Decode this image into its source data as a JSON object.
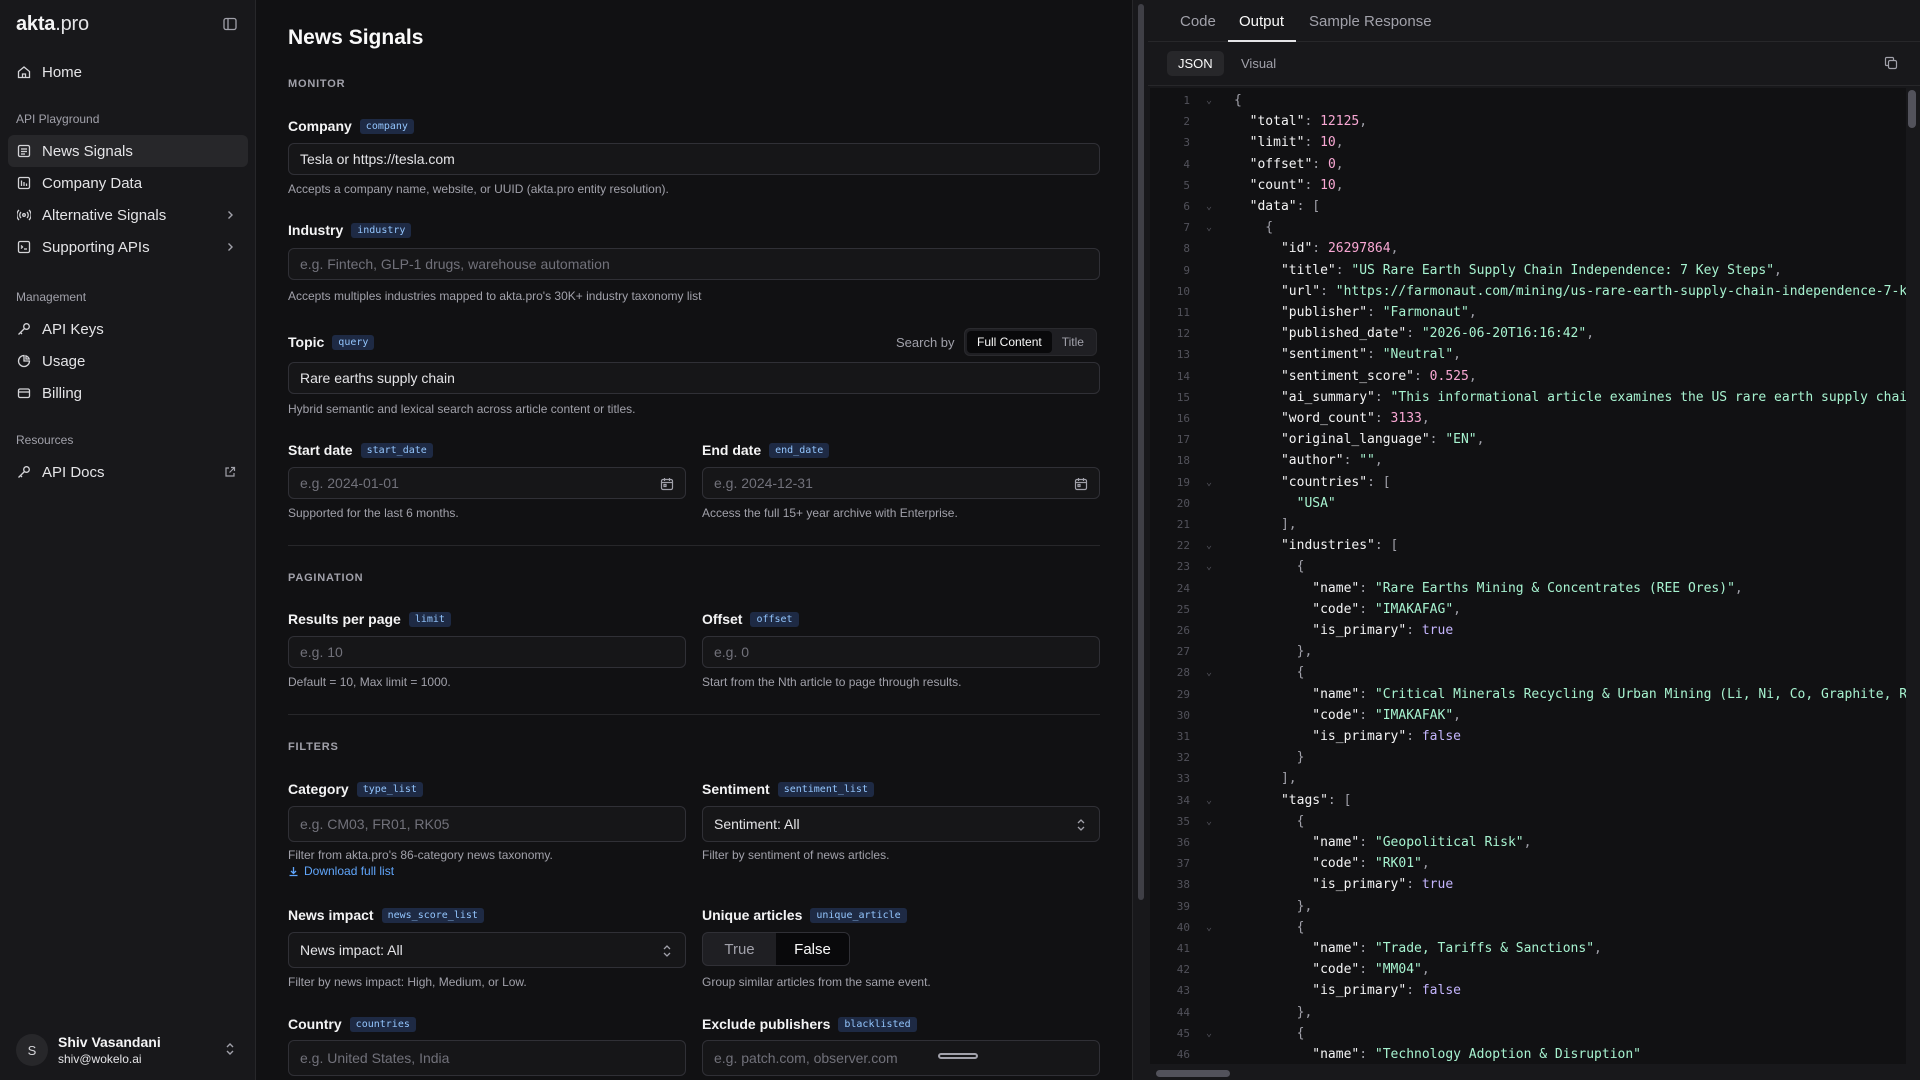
{
  "sidebar": {
    "brand_main": "akta",
    "brand_suffix": ".pro",
    "home": "Home",
    "section_playground": "API Playground",
    "news_signals": "News Signals",
    "company_data": "Company Data",
    "alternative_signals": "Alternative Signals",
    "supporting_apis": "Supporting APIs",
    "section_management": "Management",
    "api_keys": "API Keys",
    "usage": "Usage",
    "billing": "Billing",
    "section_resources": "Resources",
    "api_docs": "API Docs",
    "user_initial": "S",
    "user_name": "Shiv Vasandani",
    "user_email": "shiv@wokelo.ai"
  },
  "form": {
    "title": "News Signals",
    "monitor_label": "MONITOR",
    "company_label": "Company",
    "company_tag": "company",
    "company_value": "Tesla or https://tesla.com",
    "company_help": "Accepts a company name, website, or UUID (akta.pro entity resolution).",
    "industry_label": "Industry",
    "industry_tag": "industry",
    "industry_placeholder": "e.g. Fintech, GLP-1 drugs, warehouse automation",
    "industry_help": "Accepts multiples industries mapped to akta.pro's 30K+ industry taxonomy list",
    "topic_label": "Topic",
    "topic_tag": "query",
    "search_by": "Search by",
    "full_content": "Full Content",
    "title_opt": "Title",
    "topic_value": "Rare earths supply chain",
    "topic_help": "Hybrid semantic and lexical search across article content or titles.",
    "start_label": "Start date",
    "start_tag": "start_date",
    "start_placeholder": "e.g. 2024-01-01",
    "start_help": "Supported for the last 6 months.",
    "end_label": "End date",
    "end_tag": "end_date",
    "end_placeholder": "e.g. 2024-12-31",
    "end_help": "Access the full 15+ year archive with Enterprise.",
    "pagination_label": "PAGINATION",
    "results_label": "Results per page",
    "results_tag": "limit",
    "results_placeholder": "e.g. 10",
    "results_help": "Default = 10, Max limit = 1000.",
    "offset_label": "Offset",
    "offset_tag": "offset",
    "offset_placeholder": "e.g. 0",
    "offset_help": "Start from the Nth article to page through results.",
    "filters_label": "FILTERS",
    "category_label": "Category",
    "category_tag": "type_list",
    "category_placeholder": "e.g. CM03, FR01, RK05",
    "category_help": "Filter from akta.pro's 86-category news taxonomy.",
    "download_link": "Download full list",
    "sentiment_label": "Sentiment",
    "sentiment_tag": "sentiment_list",
    "sentiment_value": "Sentiment: All",
    "sentiment_help": "Filter by sentiment of news articles.",
    "impact_label": "News impact",
    "impact_tag": "news_score_list",
    "impact_value": "News impact: All",
    "impact_help": "Filter by news impact: High, Medium, or Low.",
    "unique_label": "Unique articles",
    "unique_tag": "unique_article",
    "unique_true": "True",
    "unique_false": "False",
    "unique_help": "Group similar articles from the same event.",
    "country_label": "Country",
    "country_tag": "countries",
    "country_placeholder": "e.g. United States, India",
    "exclude_label": "Exclude publishers",
    "exclude_tag": "blacklisted",
    "exclude_placeholder": "e.g. patch.com, observer.com"
  },
  "panel": {
    "tab_code": "Code",
    "tab_output": "Output",
    "tab_sample": "Sample Response",
    "sub_json": "JSON",
    "sub_visual": "Visual"
  },
  "code_lines": [
    [
      [
        "p",
        "{"
      ]
    ],
    [
      [
        "k",
        "  \"total\""
      ],
      [
        "p",
        ": "
      ],
      [
        "n",
        "12125"
      ],
      [
        "p",
        ","
      ]
    ],
    [
      [
        "k",
        "  \"limit\""
      ],
      [
        "p",
        ": "
      ],
      [
        "n",
        "10"
      ],
      [
        "p",
        ","
      ]
    ],
    [
      [
        "k",
        "  \"offset\""
      ],
      [
        "p",
        ": "
      ],
      [
        "n",
        "0"
      ],
      [
        "p",
        ","
      ]
    ],
    [
      [
        "k",
        "  \"count\""
      ],
      [
        "p",
        ": "
      ],
      [
        "n",
        "10"
      ],
      [
        "p",
        ","
      ]
    ],
    [
      [
        "k",
        "  \"data\""
      ],
      [
        "p",
        ": ["
      ]
    ],
    [
      [
        "p",
        "    {"
      ]
    ],
    [
      [
        "k",
        "      \"id\""
      ],
      [
        "p",
        ": "
      ],
      [
        "n",
        "26297864"
      ],
      [
        "p",
        ","
      ]
    ],
    [
      [
        "k",
        "      \"title\""
      ],
      [
        "p",
        ": "
      ],
      [
        "s",
        "\"US Rare Earth Supply Chain Independence: 7 Key Steps\""
      ],
      [
        "p",
        ","
      ]
    ],
    [
      [
        "k",
        "      \"url\""
      ],
      [
        "p",
        ": "
      ],
      [
        "s",
        "\"https://farmonaut.com/mining/us-rare-earth-supply-chain-independence-7-k"
      ]
    ],
    [
      [
        "k",
        "      \"publisher\""
      ],
      [
        "p",
        ": "
      ],
      [
        "s",
        "\"Farmonaut\""
      ],
      [
        "p",
        ","
      ]
    ],
    [
      [
        "k",
        "      \"published_date\""
      ],
      [
        "p",
        ": "
      ],
      [
        "s",
        "\"2026-06-20T16:16:42\""
      ],
      [
        "p",
        ","
      ]
    ],
    [
      [
        "k",
        "      \"sentiment\""
      ],
      [
        "p",
        ": "
      ],
      [
        "s",
        "\"Neutral\""
      ],
      [
        "p",
        ","
      ]
    ],
    [
      [
        "k",
        "      \"sentiment_score\""
      ],
      [
        "p",
        ": "
      ],
      [
        "n",
        "0.525"
      ],
      [
        "p",
        ","
      ]
    ],
    [
      [
        "k",
        "      \"ai_summary\""
      ],
      [
        "p",
        ": "
      ],
      [
        "s",
        "\"This informational article examines the US rare earth supply chai"
      ]
    ],
    [
      [
        "k",
        "      \"word_count\""
      ],
      [
        "p",
        ": "
      ],
      [
        "n",
        "3133"
      ],
      [
        "p",
        ","
      ]
    ],
    [
      [
        "k",
        "      \"original_language\""
      ],
      [
        "p",
        ": "
      ],
      [
        "s",
        "\"EN\""
      ],
      [
        "p",
        ","
      ]
    ],
    [
      [
        "k",
        "      \"author\""
      ],
      [
        "p",
        ": "
      ],
      [
        "s",
        "\"\""
      ],
      [
        "p",
        ","
      ]
    ],
    [
      [
        "k",
        "      \"countries\""
      ],
      [
        "p",
        ": ["
      ]
    ],
    [
      [
        "s",
        "        \"USA\""
      ]
    ],
    [
      [
        "p",
        "      ],"
      ]
    ],
    [
      [
        "k",
        "      \"industries\""
      ],
      [
        "p",
        ": ["
      ]
    ],
    [
      [
        "p",
        "        {"
      ]
    ],
    [
      [
        "k",
        "          \"name\""
      ],
      [
        "p",
        ": "
      ],
      [
        "s",
        "\"Rare Earths Mining & Concentrates (REE Ores)\""
      ],
      [
        "p",
        ","
      ]
    ],
    [
      [
        "k",
        "          \"code\""
      ],
      [
        "p",
        ": "
      ],
      [
        "s",
        "\"IMAKAFAG\""
      ],
      [
        "p",
        ","
      ]
    ],
    [
      [
        "k",
        "          \"is_primary\""
      ],
      [
        "p",
        ": "
      ],
      [
        "b",
        "true"
      ]
    ],
    [
      [
        "p",
        "        },"
      ]
    ],
    [
      [
        "p",
        "        {"
      ]
    ],
    [
      [
        "k",
        "          \"name\""
      ],
      [
        "p",
        ": "
      ],
      [
        "s",
        "\"Critical Minerals Recycling & Urban Mining (Li, Ni, Co, Graphite, R"
      ]
    ],
    [
      [
        "k",
        "          \"code\""
      ],
      [
        "p",
        ": "
      ],
      [
        "s",
        "\"IMAKAFAK\""
      ],
      [
        "p",
        ","
      ]
    ],
    [
      [
        "k",
        "          \"is_primary\""
      ],
      [
        "p",
        ": "
      ],
      [
        "b",
        "false"
      ]
    ],
    [
      [
        "p",
        "        }"
      ]
    ],
    [
      [
        "p",
        "      ],"
      ]
    ],
    [
      [
        "k",
        "      \"tags\""
      ],
      [
        "p",
        ": ["
      ]
    ],
    [
      [
        "p",
        "        {"
      ]
    ],
    [
      [
        "k",
        "          \"name\""
      ],
      [
        "p",
        ": "
      ],
      [
        "s",
        "\"Geopolitical Risk\""
      ],
      [
        "p",
        ","
      ]
    ],
    [
      [
        "k",
        "          \"code\""
      ],
      [
        "p",
        ": "
      ],
      [
        "s",
        "\"RK01\""
      ],
      [
        "p",
        ","
      ]
    ],
    [
      [
        "k",
        "          \"is_primary\""
      ],
      [
        "p",
        ": "
      ],
      [
        "b",
        "true"
      ]
    ],
    [
      [
        "p",
        "        },"
      ]
    ],
    [
      [
        "p",
        "        {"
      ]
    ],
    [
      [
        "k",
        "          \"name\""
      ],
      [
        "p",
        ": "
      ],
      [
        "s",
        "\"Trade, Tariffs & Sanctions\""
      ],
      [
        "p",
        ","
      ]
    ],
    [
      [
        "k",
        "          \"code\""
      ],
      [
        "p",
        ": "
      ],
      [
        "s",
        "\"MM04\""
      ],
      [
        "p",
        ","
      ]
    ],
    [
      [
        "k",
        "          \"is_primary\""
      ],
      [
        "p",
        ": "
      ],
      [
        "b",
        "false"
      ]
    ],
    [
      [
        "p",
        "        },"
      ]
    ],
    [
      [
        "p",
        "        {"
      ]
    ],
    [
      [
        "k",
        "          \"name\""
      ],
      [
        "p",
        ": "
      ],
      [
        "s",
        "\"Technology Adoption & Disruption\""
      ]
    ]
  ],
  "foldable_lines": [
    1,
    6,
    7,
    19,
    22,
    23,
    28,
    34,
    35,
    40,
    45
  ]
}
